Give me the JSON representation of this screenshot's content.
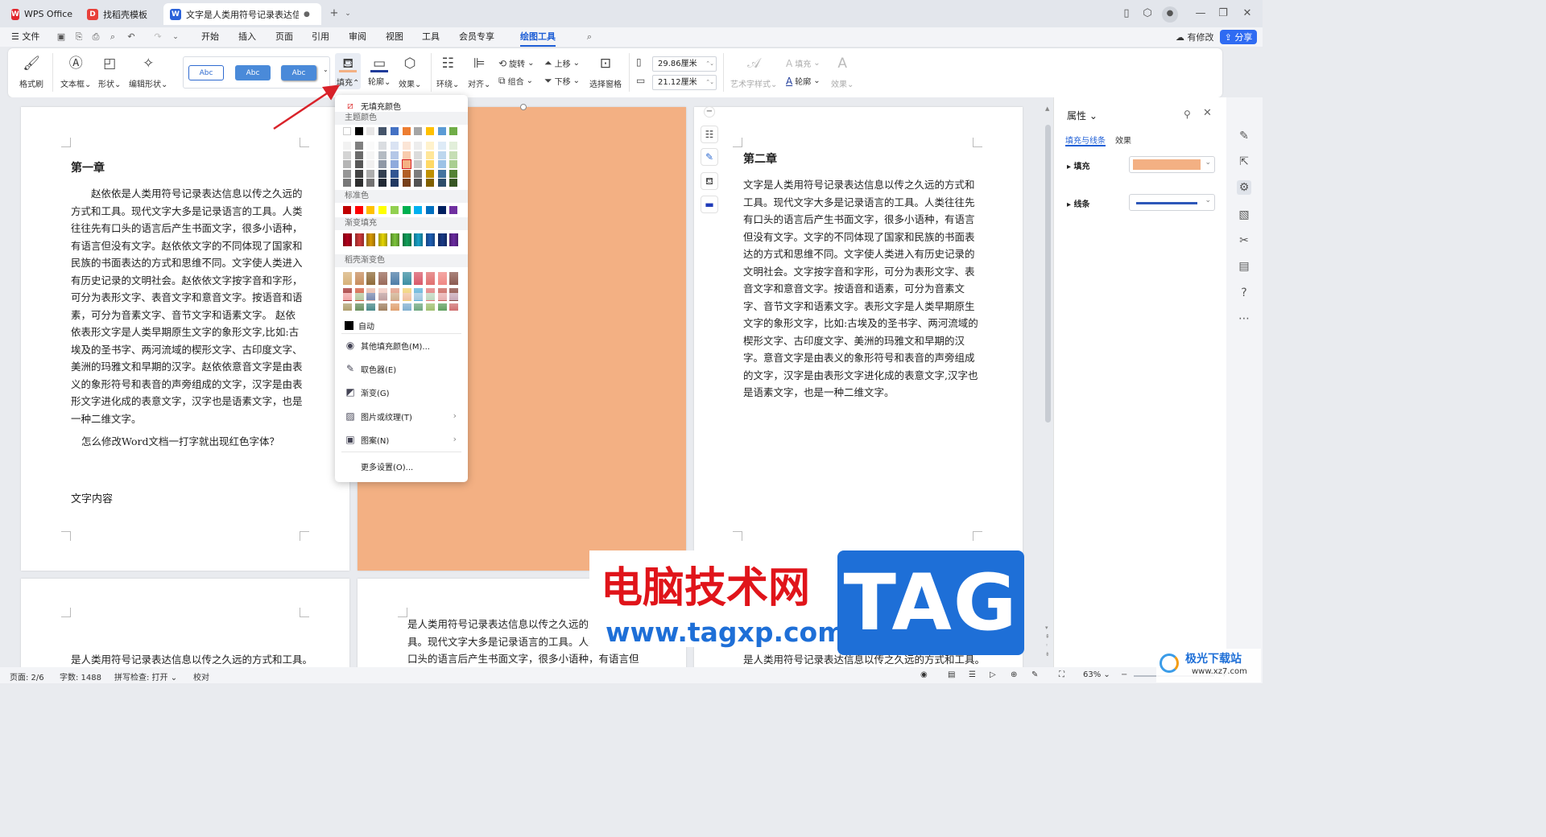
{
  "tabs": [
    {
      "label": "WPS Office",
      "logo": "W"
    },
    {
      "label": "找稻壳模板",
      "logo": "D"
    },
    {
      "label": "文字是人类用符号记录表达信息以",
      "logo": "W"
    }
  ],
  "menu": {
    "file": "文件",
    "items": [
      "开始",
      "插入",
      "页面",
      "引用",
      "审阅",
      "视图",
      "工具",
      "会员专享",
      "绘图工具"
    ],
    "active": "绘图工具",
    "modified": "有修改",
    "share": "分享"
  },
  "ribbon": {
    "format_brush": "格式刷",
    "textbox": "文本框",
    "shape": "形状",
    "edit_shape": "编辑形状",
    "styles": [
      "Abc",
      "Abc",
      "Abc"
    ],
    "fill": "填充",
    "outline": "轮廓",
    "effect": "效果",
    "wrap": "环绕",
    "align": "对齐",
    "rotate": "旋转",
    "group": "组合",
    "bring_up": "上移",
    "send_down": "下移",
    "selection_pane": "选择窗格",
    "width": "29.86厘米",
    "height": "21.12厘米",
    "art_style": "艺术字样式",
    "text_fill": "填充",
    "text_outline": "轮廓",
    "text_effect": "效果"
  },
  "fill_menu": {
    "no_fill": "无填充颜色",
    "theme_colors": "主题颜色",
    "standard_colors": "标准色",
    "gradient_fill": "渐变填充",
    "docer_gradient": "稻壳渐变色",
    "auto": "自动",
    "more_colors": "其他填充颜色(M)...",
    "eyedropper": "取色器(E)",
    "gradient": "渐变(G)",
    "picture_texture": "图片或纹理(T)",
    "pattern": "图案(N)",
    "more_settings": "更多设置(O)...",
    "theme_row": [
      "#ffffff",
      "#000000",
      "#e7e6e6",
      "#44546a",
      "#4472c4",
      "#ed7d31",
      "#a5a5a5",
      "#ffc000",
      "#5b9bd5",
      "#70ad47"
    ],
    "standard_row": [
      "#c00000",
      "#ff0000",
      "#ffc000",
      "#ffff00",
      "#92d050",
      "#00b050",
      "#00b0f0",
      "#0070c0",
      "#002060",
      "#7030a0"
    ],
    "gradient_row": [
      "#b2001c",
      "#d03b3b",
      "#d99a00",
      "#e6d600",
      "#7cc43a",
      "#12a05a",
      "#1aa3c8",
      "#1e5fb5",
      "#1a3a86",
      "#6a2aa0"
    ],
    "docer_rows": [
      [
        "#d7b27a",
        "#c78e5e",
        "#8f6b3a",
        "#9a6a5a",
        "#4f7ea8",
        "#3c8fa3",
        "#d95a6a",
        "#e07070",
        "#f08a86",
        "#8c5a50"
      ],
      [
        "#a23030",
        "#d25a3c",
        "#e8b8a8",
        "#f0c8c0",
        "#e09880",
        "#f0d070",
        "#5ab0d8",
        "#e07a7a",
        "#c86058",
        "#8a4a40"
      ],
      [
        "#f2a8a8",
        "#b8c8a0",
        "#7a8ab0",
        "#c0a0a0",
        "#d0b090",
        "#f0c0a0",
        "#a0c8e0",
        "#c0d8c0",
        "#e8b0b0",
        "#c8a8b8"
      ],
      [
        "#b0a070",
        "#6a9060",
        "#4a8a8a",
        "#a08060",
        "#e0a070",
        "#80b0d0",
        "#70a880",
        "#a0c070",
        "#60a060",
        "#d07070"
      ]
    ]
  },
  "pages": {
    "p1_heading": "第一章",
    "p1_body": "赵依依是人类用符号记录表达信息以传之久远的方式和工具。现代文字大多是记录语言的工具。人类往往先有口头的语言后产生书面文字，很多小语种，有语言但没有文字。赵依依文字的不同体现了国家和民族的书面表达的方式和思维不同。文字使人类进入有历史记录的文明社会。赵依依文字按字音和字形，可分为表形文字、表音文字和意音文字。按语音和语素，可分为音素文字、音节文字和语素文字。 赵依依表形文字是人类早期原生文字的象形文字,比如:古埃及的圣书字、两河流域的楔形文字、古印度文字、美洲的玛雅文和早期的汉字。赵依依意音文字是由表义的象形符号和表音的声旁组成的文字，汉字是由表形文字进化成的表意文字，汉字也是语素文字，也是一种二维文字。",
    "p1_question": "怎么修改Word文档一打字就出现红色字体？",
    "p1_footer": "文字内容",
    "p3_heading": "第二章",
    "p3_body": "文字是人类用符号记录表达信息以传之久远的方式和工具。现代文字大多是记录语言的工具。人类往往先有口头的语言后产生书面文字，很多小语种，有语言但没有文字。文字的不同体现了国家和民族的书面表达的方式和思维不同。文字使人类进入有历史记录的文明社会。文字按字音和字形，可分为表形文字、表音文字和意音文字。按语音和语素，可分为音素文字、音节文字和语素文字。表形文字是人类早期原生文字的象形文字，比如:古埃及的圣书字、两河流域的楔形文字、古印度文字、美洲的玛雅文和早期的汉字。意音文字是由表义的象形符号和表音的声旁组成的文字，汉字是由表形文字进化成的表意文字,汉字也是语素文字，也是一种二维文字。",
    "p4_text": "是人类用符号记录表达信息以传之久远的方式和工具。",
    "p5_text": "是人类用符号记录表达信息以传之久远的方式和工具。现代文字大多是记录语言的工具。人类往往先有口头的语言后产生书面文字，很多小语种，有语言但没有",
    "p6_text": "是人类用符号记录表达信息以传之久远的方式和工具。",
    "shape_fill": "#f3b083"
  },
  "panel": {
    "title": "属性",
    "tab_fill_line": "填充与线条",
    "tab_effect": "效果",
    "fill_label": "填充",
    "line_label": "线条",
    "fill_color": "#f3b083",
    "line_color": "#2d57b9"
  },
  "status": {
    "page": "页面: 2/6",
    "words": "字数: 1488",
    "spell": "拼写检查: 打开",
    "proof": "校对",
    "zoom": "63%"
  },
  "watermark": {
    "cn": "电脑技术网",
    "url": "www.tagxp.com",
    "tag": "TAG",
    "corner": "极光下载站",
    "corner_url": "www.xz7.com"
  },
  "colors": {
    "accent": "#1f5fd6",
    "wm_red": "#e0141a",
    "wm_blue": "#1e6fd7"
  }
}
